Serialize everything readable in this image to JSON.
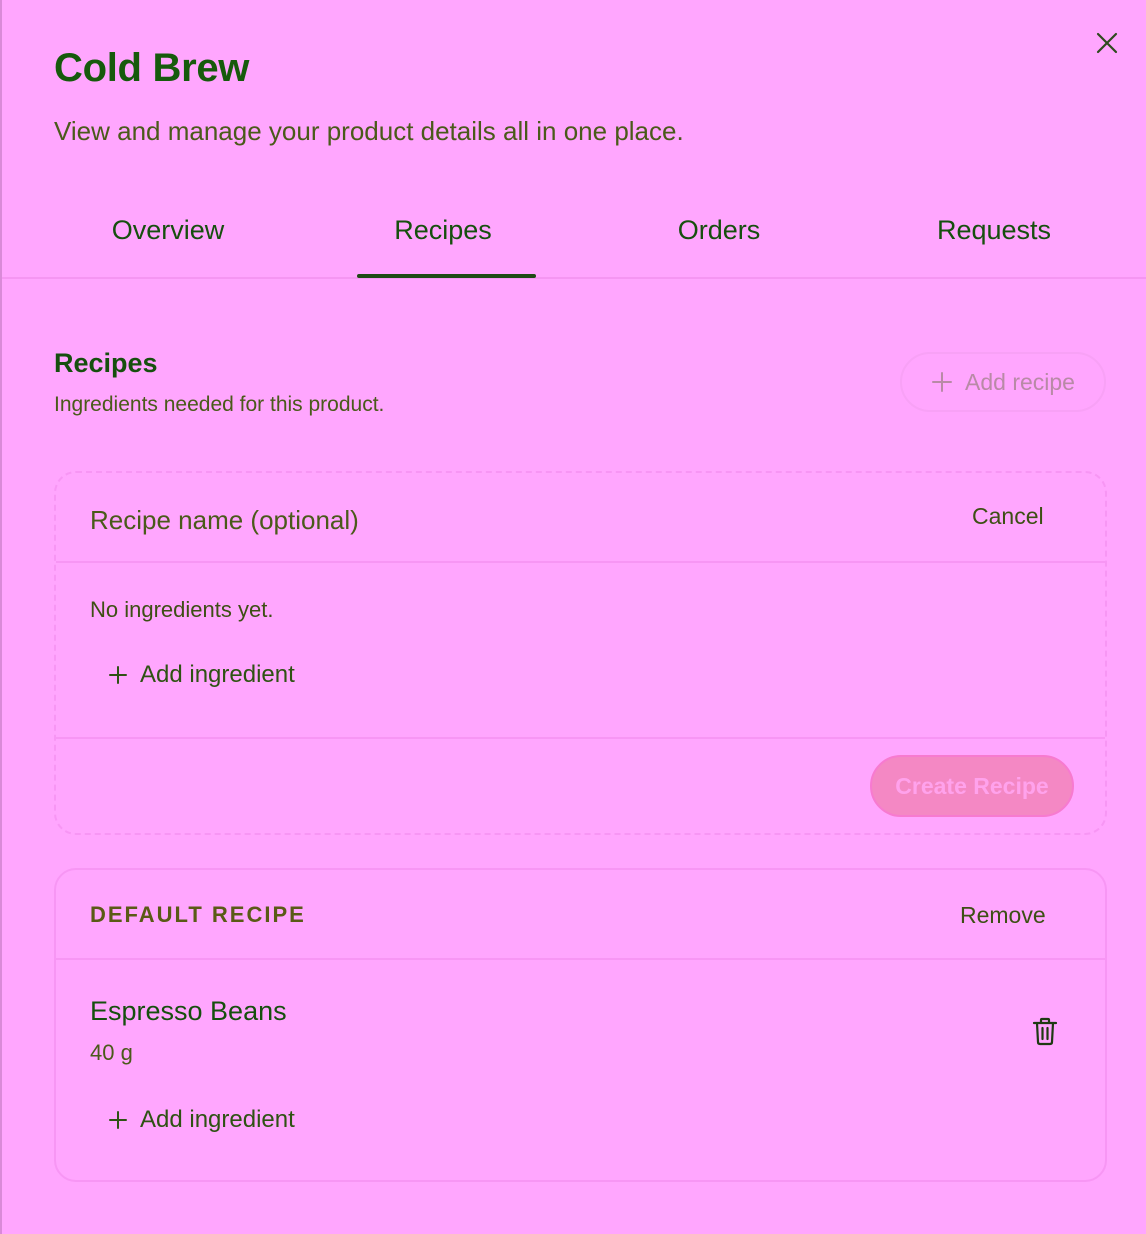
{
  "product": {
    "title": "Cold Brew",
    "subtitle": "View and manage your product details all in one place."
  },
  "tabs": [
    {
      "label": "Overview",
      "active": false
    },
    {
      "label": "Recipes",
      "active": true
    },
    {
      "label": "Orders",
      "active": false
    },
    {
      "label": "Requests",
      "active": false
    }
  ],
  "recipes_section": {
    "title": "Recipes",
    "subtitle": "Ingredients needed for this product.",
    "add_recipe_label": "Add recipe"
  },
  "new_recipe": {
    "name_placeholder": "Recipe name (optional)",
    "name_value": "",
    "cancel_label": "Cancel",
    "empty_text": "No ingredients yet.",
    "add_ingredient_label": "Add ingredient",
    "create_label": "Create Recipe"
  },
  "default_recipe": {
    "label": "DEFAULT RECIPE",
    "remove_label": "Remove",
    "ingredients": [
      {
        "name": "Espresso Beans",
        "quantity": "40 g"
      }
    ],
    "add_ingredient_label": "Add ingredient"
  },
  "icons": {
    "close": "close-icon",
    "plus": "plus-icon",
    "trash": "trash-icon"
  },
  "colors": {
    "background": "#ffa6fe",
    "text_primary": "#164f0e",
    "text_secondary": "#4a5a1a",
    "border": "#f796f4",
    "create_button": "#f488c4"
  }
}
